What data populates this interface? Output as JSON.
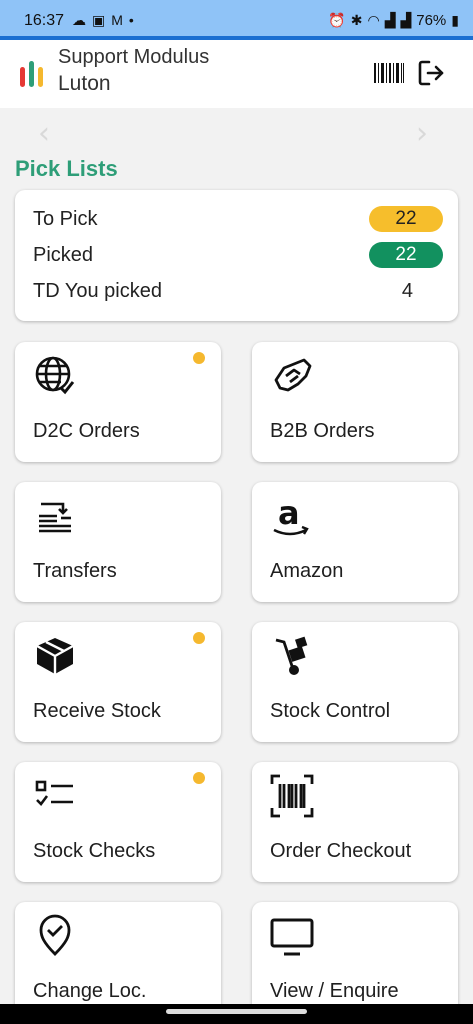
{
  "status": {
    "time": "16:37",
    "left_icons": [
      "cloud-icon",
      "image-icon",
      "mail-icon",
      "dot-icon"
    ],
    "right_icons": [
      "alarm-icon",
      "bluetooth-icon",
      "wifi-icon",
      "signal-icon",
      "signal-icon"
    ],
    "battery": "76%"
  },
  "header": {
    "line1": "Support Modulus",
    "line2": "Luton",
    "logo_colors": [
      "#e53935",
      "#2e9e78",
      "#f5b82e"
    ]
  },
  "carousel": {
    "left": "‹",
    "right": "›"
  },
  "pick_lists": {
    "title": "Pick Lists",
    "rows": [
      {
        "label": "To Pick",
        "value": "22",
        "color": "#f6be2c"
      },
      {
        "label": "Picked",
        "value": "22",
        "color": "#12915f"
      },
      {
        "label": "TD You picked",
        "value": "4"
      }
    ]
  },
  "tiles": [
    {
      "label": "D2C Orders",
      "icon": "globe-check-icon",
      "dot": true
    },
    {
      "label": "B2B Orders",
      "icon": "handshake-icon",
      "dot": false
    },
    {
      "label": "Transfers",
      "icon": "transfer-icon",
      "dot": false
    },
    {
      "label": "Amazon",
      "icon": "amazon-icon",
      "dot": false
    },
    {
      "label": "Receive Stock",
      "icon": "box-icon",
      "dot": true
    },
    {
      "label": "Stock Control",
      "icon": "hand-truck-icon",
      "dot": false
    },
    {
      "label": "Stock Checks",
      "icon": "checklist-icon",
      "dot": true
    },
    {
      "label": "Order Checkout",
      "icon": "barcode-scan-icon",
      "dot": false
    },
    {
      "label": "Change Loc.",
      "icon": "location-check-icon",
      "dot": false
    },
    {
      "label": "View / Enquire",
      "icon": "monitor-icon",
      "dot": false
    }
  ],
  "colors": {
    "accent": "#2e9e78",
    "dot": "#f5b82e",
    "statusbar": "#8fc3f7"
  }
}
